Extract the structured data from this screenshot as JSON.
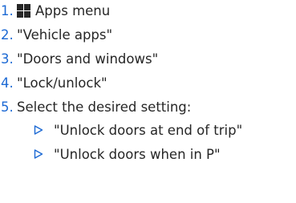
{
  "steps": [
    {
      "num": "1.",
      "icon": "apps-grid-icon",
      "text": "Apps menu"
    },
    {
      "num": "2.",
      "text": "\"Vehicle apps\""
    },
    {
      "num": "3.",
      "text": "\"Doors and windows\""
    },
    {
      "num": "4.",
      "text": "\"Lock/unlock\""
    },
    {
      "num": "5.",
      "text": "Select the desired setting:"
    }
  ],
  "substeps": [
    {
      "icon": "triangle-right-icon",
      "text": "\"Unlock doors at end of trip\""
    },
    {
      "icon": "triangle-right-icon",
      "text": "\"Unlock doors when in P\""
    }
  ],
  "colors": {
    "accent": "#1c69d4",
    "text": "#262626"
  }
}
